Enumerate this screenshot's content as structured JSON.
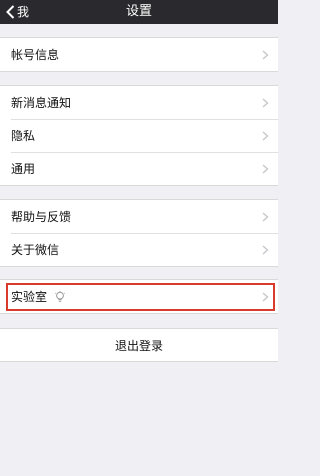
{
  "navbar": {
    "back_label": "我",
    "title": "设置"
  },
  "groups": [
    {
      "items": [
        {
          "label": "帐号信息"
        }
      ]
    },
    {
      "items": [
        {
          "label": "新消息通知"
        },
        {
          "label": "隐私"
        },
        {
          "label": "通用"
        }
      ]
    },
    {
      "items": [
        {
          "label": "帮助与反馈"
        },
        {
          "label": "关于微信"
        }
      ]
    },
    {
      "items": [
        {
          "label": "实验室",
          "icon": "lightbulb-icon"
        }
      ]
    }
  ],
  "logout_label": "退出登录",
  "colors": {
    "navbar_bg": "#2a2a2e",
    "page_bg": "#efeff4",
    "highlight": "#d93a2b",
    "chevron": "#c7c7cc"
  }
}
